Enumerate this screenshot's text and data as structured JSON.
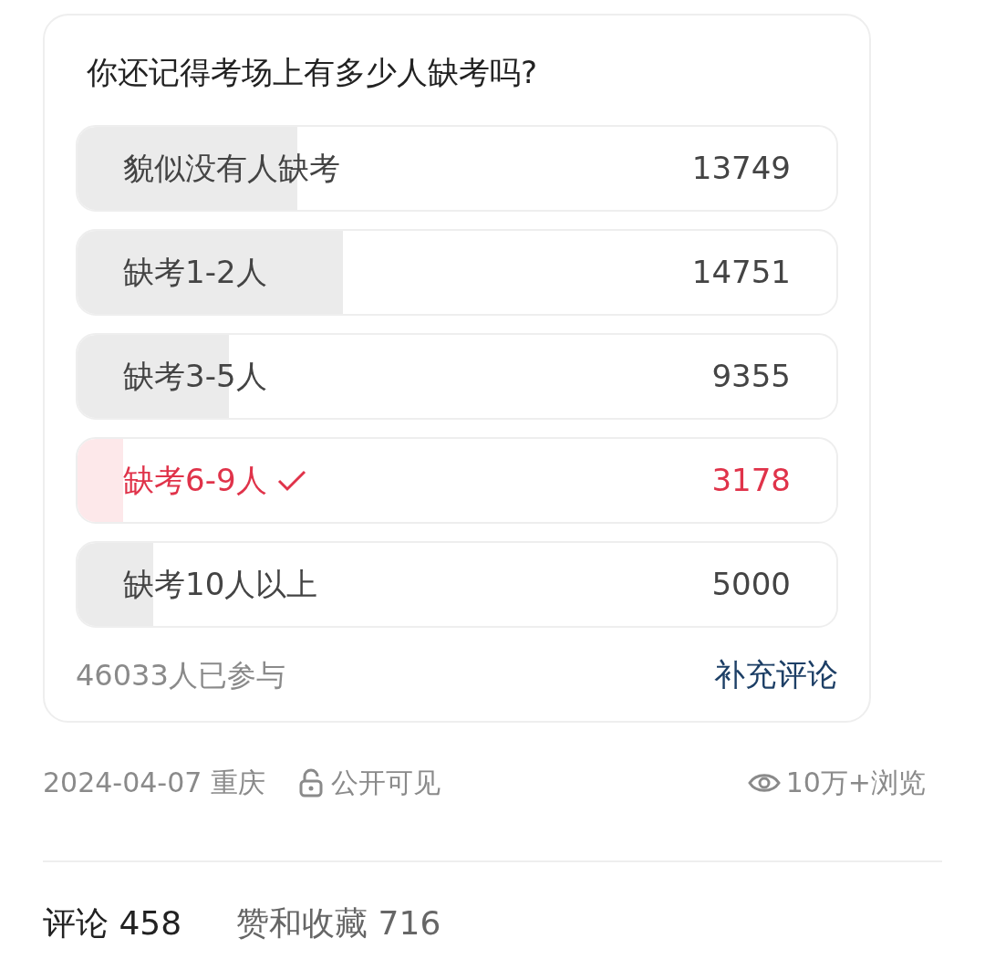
{
  "poll": {
    "question": "你还记得考场上有多少人缺考吗?",
    "options": [
      {
        "label": "貌似没有人缺考",
        "count": "13749",
        "level": 0.29,
        "selected": false
      },
      {
        "label": "缺考1-2人",
        "count": "14751",
        "level": 0.35,
        "selected": false
      },
      {
        "label": "缺考3-5人",
        "count": "9355",
        "level": 0.2,
        "selected": false
      },
      {
        "label": "缺考6-9人",
        "count": "3178",
        "level": 0.06,
        "selected": true
      },
      {
        "label": "缺考10人以上",
        "count": "5000",
        "level": 0.1,
        "selected": false
      }
    ],
    "participants": "46033人已参与",
    "comment_link": "补充评论"
  },
  "meta": {
    "date_location": "2024-04-07 重庆",
    "visibility": "公开可见",
    "views": "10万+浏览"
  },
  "tabs": [
    {
      "label": "评论 458",
      "selected": true
    },
    {
      "label": "赞和收藏 716",
      "selected": false
    }
  ]
}
